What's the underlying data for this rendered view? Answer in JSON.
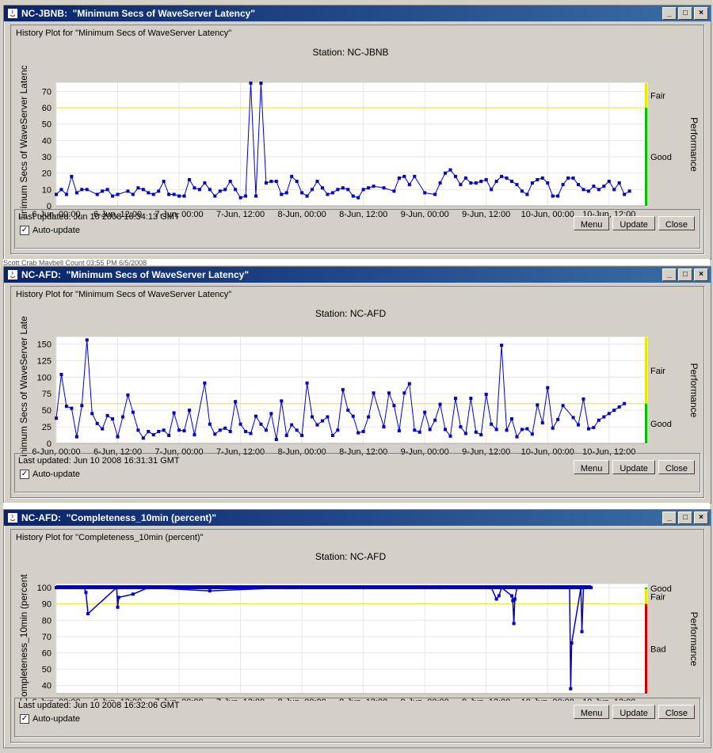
{
  "windows": [
    {
      "title": "NC-JBNB:  \"Minimum Secs of WaveServer Latency\"",
      "history_label": "History Plot for \"Minimum Secs of WaveServer Latency\"",
      "last_updated": "Last updated:  Jun 10 2008 16:34:13 GMT",
      "auto_update_label": "Auto-update",
      "buttons": {
        "menu": "Menu",
        "update": "Update",
        "close": "Close"
      }
    },
    {
      "title": "NC-AFD:  \"Minimum Secs of WaveServer Latency\"",
      "history_label": "History Plot for \"Minimum Secs of WaveServer Latency\"",
      "last_updated": "Last updated:  Jun 10 2008 16:31:31 GMT",
      "auto_update_label": "Auto-update",
      "buttons": {
        "menu": "Menu",
        "update": "Update",
        "close": "Close"
      }
    },
    {
      "title": "NC-AFD:  \"Completeness_10min (percent)\"",
      "history_label": "History Plot for \"Completeness_10min (percent)\"",
      "last_updated": "Last updated:  Jun 10 2008 16:32:06 GMT",
      "auto_update_label": "Auto-update",
      "buttons": {
        "menu": "Menu",
        "update": "Update",
        "close": "Close"
      }
    }
  ],
  "background_strips": [
    "Scott   Crab   Maybell   Count   03:55 PM 6/5/2008",
    "   "
  ],
  "colors": {
    "series": "#0000c8",
    "fair_line": "#e8e800",
    "good": "#00c000",
    "bad": "#cc0000",
    "active_title": "#0a246a"
  },
  "chart_data": [
    {
      "type": "line",
      "title": "Station:  NC-JBNB",
      "xlabel": "Time",
      "ylabel": "Minimum Secs of WaveServer Latenc",
      "right_label": "Performance",
      "zones": [
        {
          "label": "Fair",
          "from": 60,
          "to": 75
        },
        {
          "label": "Good",
          "from": 0,
          "to": 60
        }
      ],
      "threshold": 60,
      "ylim": [
        0,
        75
      ],
      "yticks": [
        0,
        10,
        20,
        30,
        40,
        50,
        60,
        70
      ],
      "xlim": [
        0,
        115
      ],
      "xticks": [
        {
          "x": 0,
          "label": "6-Jun, 00:00"
        },
        {
          "x": 12,
          "label": "6-Jun, 12:00"
        },
        {
          "x": 24,
          "label": "7-Jun, 00:00"
        },
        {
          "x": 36,
          "label": "7-Jun, 12:00"
        },
        {
          "x": 48,
          "label": "8-Jun, 00:00"
        },
        {
          "x": 60,
          "label": "8-Jun, 12:00"
        },
        {
          "x": 72,
          "label": "9-Jun, 00:00"
        },
        {
          "x": 84,
          "label": "9-Jun, 12:00"
        },
        {
          "x": 96,
          "label": "10-Jun, 00:00"
        },
        {
          "x": 108,
          "label": "10-Jun, 12:00"
        }
      ],
      "x": [
        0,
        1,
        2,
        3,
        4,
        5,
        6,
        8,
        9,
        10,
        11,
        12,
        14,
        15,
        16,
        17,
        18,
        19,
        20,
        21,
        22,
        23,
        24,
        25,
        26,
        27,
        28,
        29,
        30,
        31,
        32,
        33,
        34,
        35,
        36,
        37,
        38,
        39,
        40,
        41,
        42,
        43,
        44,
        45,
        46,
        47,
        48,
        49,
        50,
        51,
        52,
        53,
        54,
        55,
        56,
        57,
        58,
        59,
        60,
        61,
        62,
        64,
        66,
        67,
        68,
        69,
        70,
        72,
        74,
        75,
        76,
        77,
        78,
        79,
        80,
        81,
        82,
        83,
        84,
        85,
        86,
        87,
        88,
        89,
        90,
        91,
        92,
        93,
        94,
        95,
        96,
        97,
        98,
        99,
        100,
        101,
        102,
        103,
        104,
        105,
        106,
        107,
        108,
        109,
        110,
        111,
        112
      ],
      "y": [
        7,
        10,
        7,
        18,
        8,
        10,
        10,
        7,
        9,
        10,
        6,
        7,
        9,
        7,
        11,
        10,
        8,
        7,
        9,
        15,
        7,
        7,
        6,
        6,
        16,
        11,
        10,
        14,
        10,
        6,
        9,
        10,
        15,
        10,
        5,
        6,
        160,
        6,
        160,
        14,
        15,
        15,
        7,
        8,
        18,
        15,
        8,
        6,
        10,
        15,
        11,
        7,
        8,
        10,
        11,
        10,
        6,
        5,
        10,
        11,
        12,
        11,
        9,
        17,
        18,
        13,
        18,
        8,
        7,
        14,
        20,
        22,
        18,
        13,
        17,
        14,
        14,
        15,
        16,
        10,
        15,
        18,
        17,
        15,
        13,
        9,
        7,
        14,
        16,
        17,
        14,
        6,
        6,
        13,
        17,
        17,
        13,
        10,
        9,
        12,
        10,
        12,
        15,
        10,
        14,
        7,
        9
      ]
    },
    {
      "type": "line",
      "title": "Station:  NC-AFD",
      "xlabel": "Time",
      "ylabel": "Minimum Secs of WaveServer Late",
      "right_label": "Performance",
      "zones": [
        {
          "label": "Fair",
          "from": 60,
          "to": 160
        },
        {
          "label": "Good",
          "from": 0,
          "to": 60
        }
      ],
      "threshold": 60,
      "ylim": [
        0,
        160
      ],
      "yticks": [
        0,
        25,
        50,
        75,
        100,
        125,
        150
      ],
      "xlim": [
        0,
        115
      ],
      "xticks": [
        {
          "x": 0,
          "label": "6-Jun, 00:00"
        },
        {
          "x": 12,
          "label": "6-Jun, 12:00"
        },
        {
          "x": 24,
          "label": "7-Jun, 00:00"
        },
        {
          "x": 36,
          "label": "7-Jun, 12:00"
        },
        {
          "x": 48,
          "label": "8-Jun, 00:00"
        },
        {
          "x": 60,
          "label": "8-Jun, 12:00"
        },
        {
          "x": 72,
          "label": "9-Jun, 00:00"
        },
        {
          "x": 84,
          "label": "9-Jun, 12:00"
        },
        {
          "x": 96,
          "label": "10-Jun, 00:00"
        },
        {
          "x": 108,
          "label": "10-Jun, 12:00"
        }
      ],
      "x": [
        0,
        1,
        2,
        3,
        4,
        5,
        6,
        7,
        8,
        9,
        10,
        11,
        12,
        13,
        14,
        15,
        16,
        17,
        18,
        19,
        20,
        21,
        22,
        23,
        24,
        25,
        26,
        27,
        29,
        30,
        31,
        32,
        33,
        34,
        35,
        36,
        37,
        38,
        39,
        40,
        41,
        42,
        43,
        44,
        45,
        46,
        47,
        48,
        49,
        50,
        51,
        52,
        53,
        54,
        55,
        56,
        57,
        58,
        59,
        60,
        61,
        62,
        64,
        65,
        66,
        67,
        68,
        69,
        70,
        71,
        72,
        73,
        74,
        75,
        76,
        77,
        78,
        79,
        80,
        81,
        82,
        83,
        84,
        85,
        86,
        87,
        88,
        89,
        90,
        91,
        92,
        93,
        94,
        95,
        96,
        97,
        98,
        99,
        101,
        102,
        103,
        104,
        105,
        106,
        107,
        108,
        109,
        110,
        111
      ],
      "y": [
        38,
        104,
        56,
        53,
        10,
        57,
        156,
        45,
        30,
        22,
        42,
        37,
        10,
        40,
        73,
        47,
        20,
        8,
        18,
        13,
        18,
        20,
        12,
        46,
        20,
        19,
        50,
        13,
        91,
        29,
        14,
        20,
        23,
        18,
        63,
        29,
        18,
        15,
        41,
        29,
        20,
        45,
        6,
        64,
        12,
        28,
        20,
        12,
        91,
        40,
        28,
        34,
        40,
        12,
        20,
        81,
        50,
        41,
        16,
        18,
        40,
        76,
        25,
        76,
        57,
        19,
        76,
        90,
        20,
        17,
        47,
        21,
        35,
        59,
        21,
        11,
        68,
        25,
        15,
        68,
        17,
        13,
        74,
        29,
        21,
        148,
        20,
        37,
        10,
        21,
        22,
        14,
        58,
        31,
        84,
        23,
        36,
        57,
        39,
        28,
        67,
        22,
        24,
        35,
        40,
        45,
        50,
        55,
        60
      ]
    },
    {
      "type": "line",
      "title": "Station:  NC-AFD",
      "xlabel": "Time",
      "ylabel": "Completeness_10min (percent",
      "right_label": "Performance",
      "zones": [
        {
          "label": "Good",
          "from": 99,
          "to": 100
        },
        {
          "label": "Fair",
          "from": 90,
          "to": 99
        },
        {
          "label": "Bad",
          "from": 35,
          "to": 90
        }
      ],
      "threshold": 90,
      "ylim": [
        35,
        102
      ],
      "yticks": [
        40,
        50,
        60,
        70,
        80,
        90,
        100
      ],
      "xlim": [
        0,
        115
      ],
      "xticks": [
        {
          "x": 0,
          "label": "6-Jun, 00:00"
        },
        {
          "x": 12,
          "label": "6-Jun, 12:00"
        },
        {
          "x": 24,
          "label": "7-Jun, 00:00"
        },
        {
          "x": 36,
          "label": "7-Jun, 12:00"
        },
        {
          "x": 48,
          "label": "8-Jun, 00:00"
        },
        {
          "x": 60,
          "label": "8-Jun, 12:00"
        },
        {
          "x": 72,
          "label": "9-Jun, 00:00"
        },
        {
          "x": 84,
          "label": "9-Jun, 12:00"
        },
        {
          "x": 96,
          "label": "10-Jun, 00:00"
        },
        {
          "x": 108,
          "label": "10-Jun, 12:00"
        }
      ],
      "x": [
        0,
        5.5,
        5.8,
        6.2,
        11.8,
        12.0,
        12.2,
        15,
        18,
        30,
        45,
        60,
        75,
        85,
        86,
        86.5,
        87,
        89,
        89.2,
        89.4,
        89.6,
        90,
        95,
        100.3,
        100.5,
        100.7,
        102.5,
        102.7,
        103,
        104.5
      ],
      "y": [
        100,
        100,
        97,
        84,
        100,
        88,
        94,
        96,
        100,
        98,
        100,
        100,
        100,
        100,
        93,
        95,
        100,
        95,
        92,
        78,
        93,
        100,
        100,
        100,
        38,
        66,
        100,
        73,
        100,
        100
      ]
    }
  ]
}
